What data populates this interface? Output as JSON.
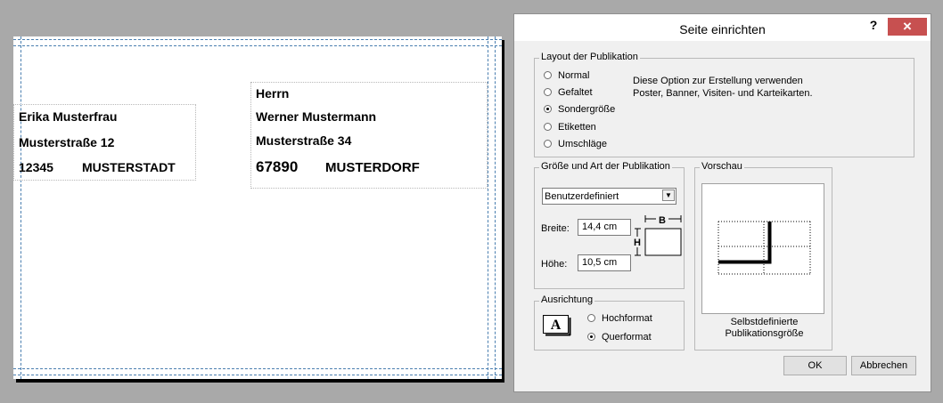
{
  "envelope": {
    "sender": {
      "name": "Erika Musterfrau",
      "street": "Musterstraße 12",
      "zip": "12345",
      "city": "MUSTERSTADT"
    },
    "recipient": {
      "salutation": "Herrn",
      "name": "Werner Mustermann",
      "street": "Musterstraße 34",
      "zip": "67890",
      "city": "MUSTERDORF"
    }
  },
  "dialog": {
    "title": "Seite einrichten",
    "help": "?",
    "close": "×",
    "layout": {
      "legend": "Layout der Publikation",
      "options": [
        "Normal",
        "Gefaltet",
        "Sondergröße",
        "Etiketten",
        "Umschläge"
      ],
      "selected": "Sondergröße",
      "description_line1": "Diese Option zur Erstellung verwenden",
      "description_line2": "Poster, Banner, Visiten- und Karteikarten."
    },
    "size": {
      "legend": "Größe und Art der Publikation",
      "dropdown_value": "Benutzerdefiniert",
      "width_label": "Breite:",
      "width_value": "14,4 cm",
      "height_label": "Höhe:",
      "height_value": "10,5 cm",
      "diagram_b": "B",
      "diagram_h": "H"
    },
    "orientation": {
      "legend": "Ausrichtung",
      "icon_letter": "A",
      "options": [
        "Hochformat",
        "Querformat"
      ],
      "selected": "Querformat"
    },
    "preview": {
      "legend": "Vorschau",
      "caption_line1": "Selbstdefinierte",
      "caption_line2": "Publikationsgröße"
    },
    "ok_label": "OK",
    "cancel_label": "Abbrechen",
    "colors": {
      "close_button": "#c75050",
      "guides": "#4a7fb0"
    }
  }
}
